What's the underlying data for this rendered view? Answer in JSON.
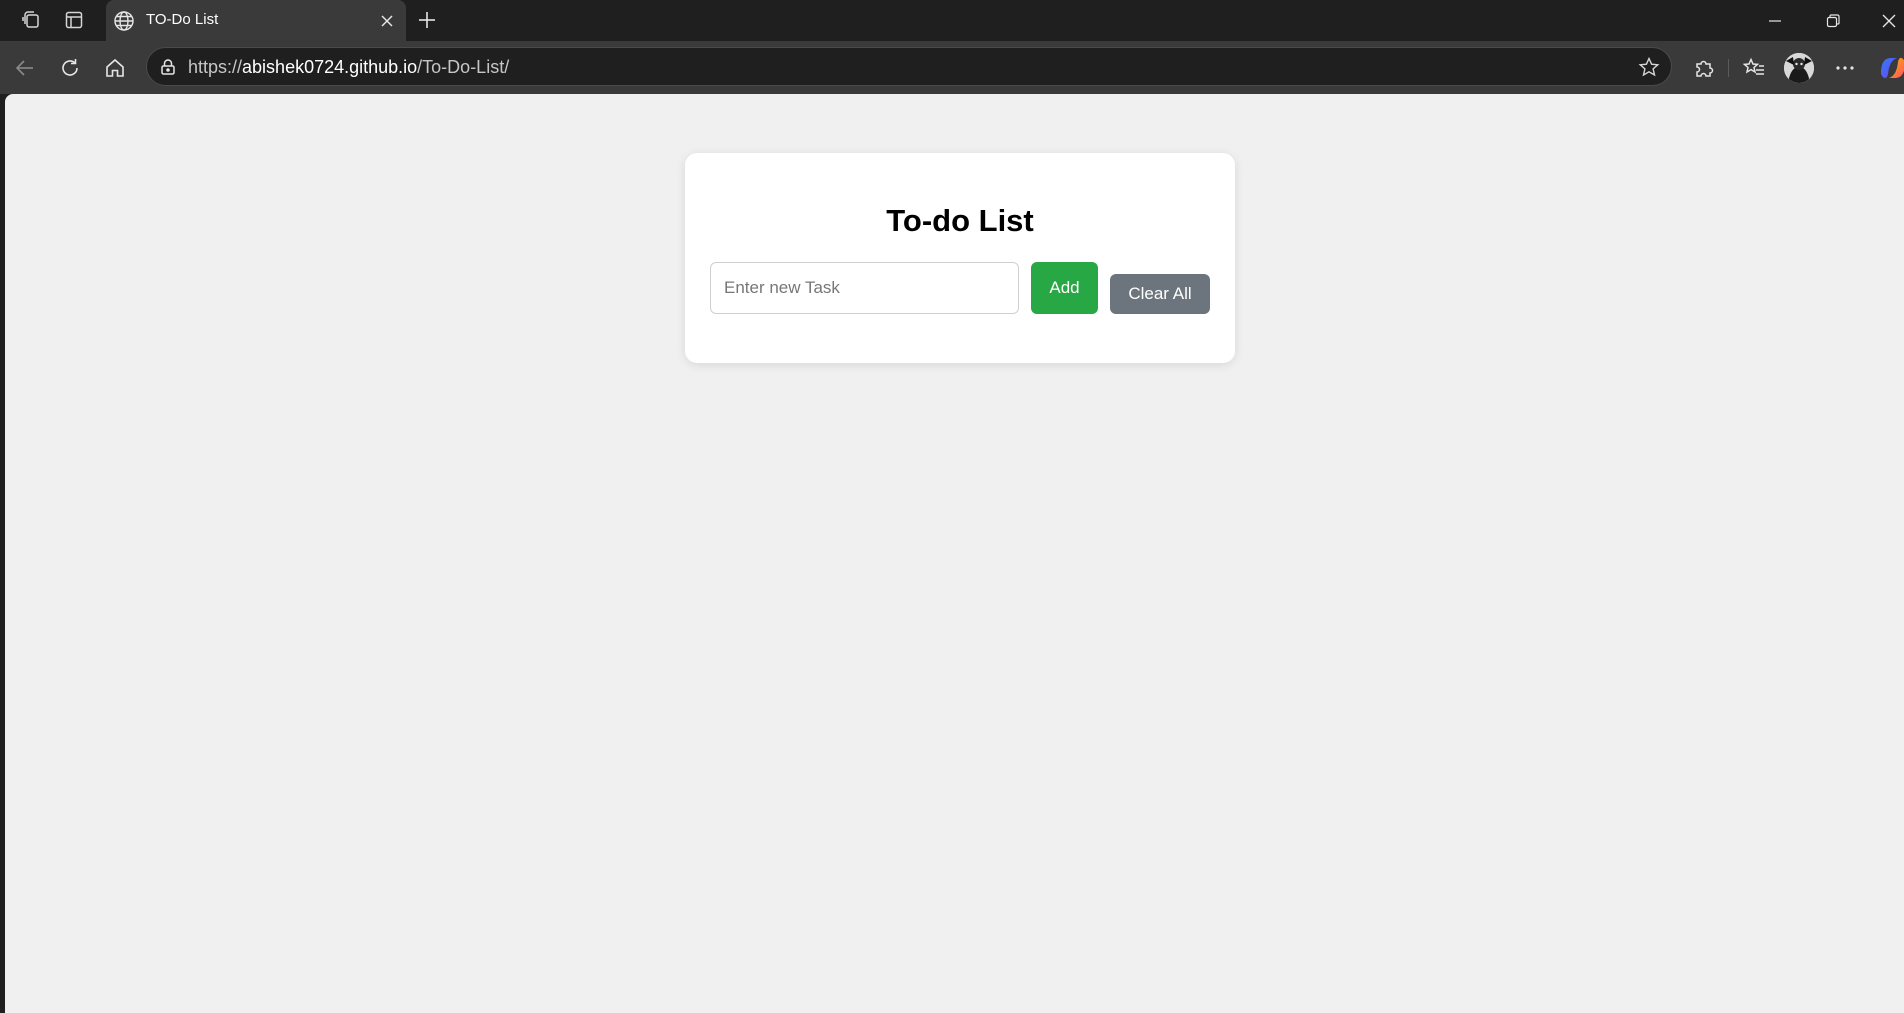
{
  "browser": {
    "tab": {
      "title": "TO-Do List"
    },
    "address": {
      "protocol": "https://",
      "host": "abishek0724.github.io",
      "path": "/To-Do-List/"
    }
  },
  "page": {
    "title": "To-do List",
    "input": {
      "placeholder": "Enter new Task",
      "value": ""
    },
    "add_label": "Add",
    "clear_label": "Clear All"
  },
  "colors": {
    "add_button": "#28a745",
    "clear_button": "#6c757d",
    "page_background": "#f0f0f0"
  },
  "icons": {
    "workspaces": "workspaces-icon",
    "tab_actions": "tab-actions-icon",
    "favicon": "globe-icon",
    "close_tab": "close-icon",
    "new_tab": "plus-icon",
    "back": "back-arrow-icon",
    "refresh": "refresh-icon",
    "home": "home-icon",
    "site_info": "lock-icon",
    "favorite": "star-icon",
    "extensions": "puzzle-icon",
    "favorites": "favorites-icon",
    "more": "more-icon",
    "copilot": "copilot-icon"
  }
}
